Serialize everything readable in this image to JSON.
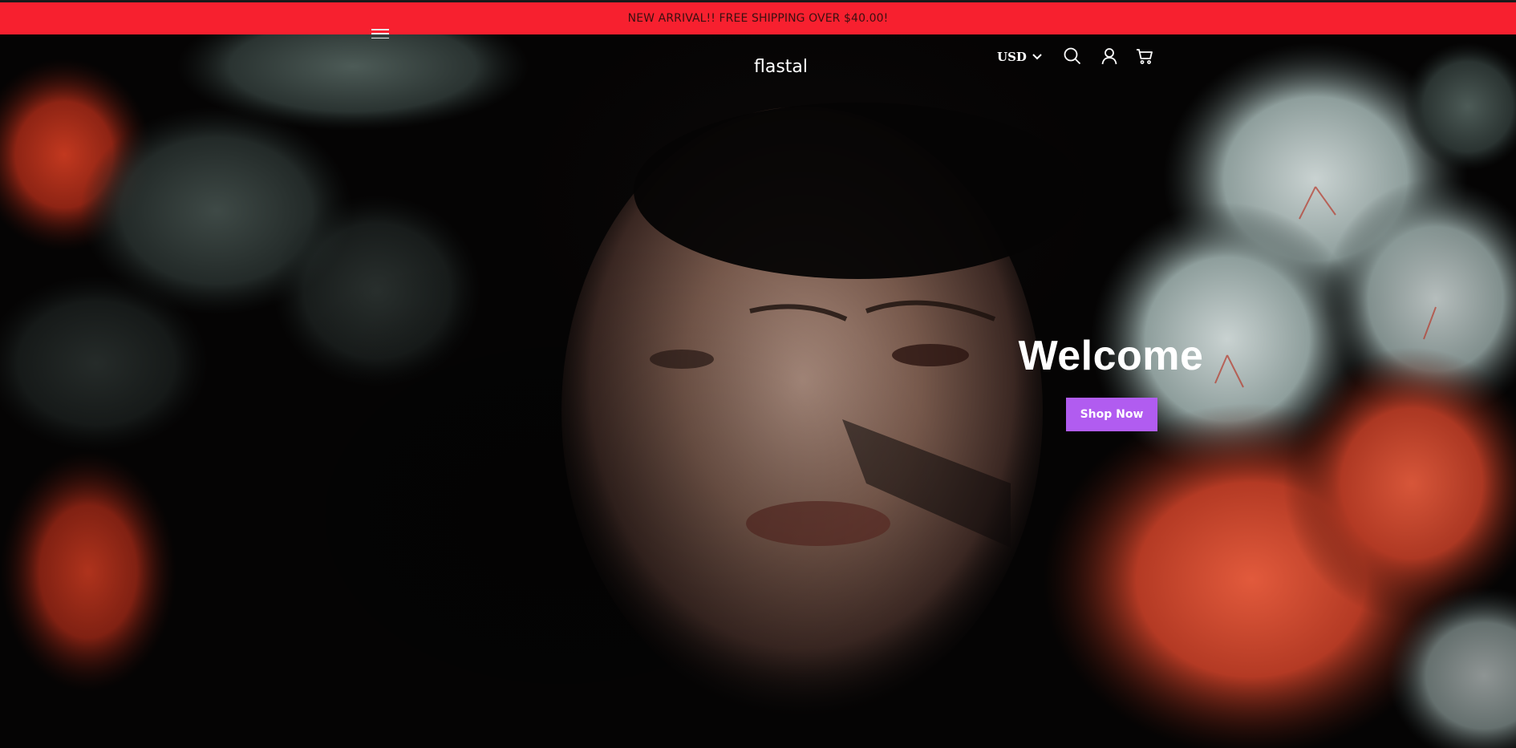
{
  "announcement": {
    "text": "NEW ARRIVAL!! FREE SHIPPING OVER $40.00!"
  },
  "header": {
    "logo": "flastal",
    "currency": "USD",
    "icons": [
      "menu-icon",
      "search-icon",
      "account-icon",
      "cart-icon"
    ]
  },
  "hero": {
    "title": "Welcome",
    "cta_label": "Shop Now",
    "image": "woman-face-among-flowers"
  },
  "colors": {
    "announcement_bg": "#f7202f",
    "cta_bg": "#b15cf0",
    "text_light": "#ffffff"
  }
}
